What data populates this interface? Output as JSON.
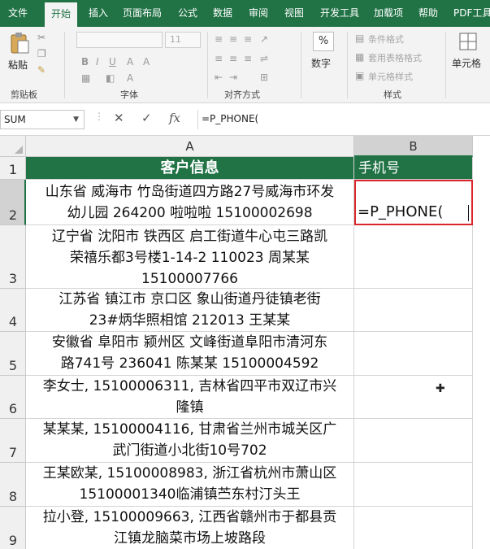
{
  "menu": {
    "tabs": [
      "文件",
      "开始",
      "插入",
      "页面布局",
      "公式",
      "数据",
      "审阅",
      "视图",
      "开发工具",
      "加载项",
      "帮助",
      "PDF工具"
    ],
    "active": "开始"
  },
  "ribbon": {
    "clipboard": {
      "paste_label": "粘贴",
      "group_label": "剪贴板"
    },
    "font": {
      "size_value": "11",
      "group_label": "字体"
    },
    "alignment": {
      "group_label": "对齐方式"
    },
    "number": {
      "symbol": "%",
      "label": "数字"
    },
    "styles": {
      "items": [
        "条件格式",
        "套用表格格式",
        "单元格样式"
      ],
      "group_label": "样式"
    },
    "cells": {
      "label": "单元格"
    }
  },
  "formula_bar": {
    "name_box": "SUM",
    "cancel_icon": "✕",
    "enter_icon": "✓",
    "fx_label": "fx",
    "formula": "=P_PHONE("
  },
  "grid": {
    "columns": [
      "A",
      "B"
    ],
    "rows": [
      "1",
      "2",
      "3",
      "4",
      "5",
      "6",
      "7",
      "8",
      "9"
    ],
    "header_a": "客户信息",
    "header_b": "手机号",
    "cells_a": [
      [
        "山东省  威海市 竹岛街道四方路27号威海市环发",
        "幼儿园  264200  啦啦啦  15100002698"
      ],
      [
        "辽宁省  沈阳市  铁西区  启工街道牛心屯三路凯",
        "荣禧乐都3号楼1-14-2  110023  周某某",
        "15100007766"
      ],
      [
        "江苏省  镇江市  京口区  象山街道丹徒镇老街",
        "23#炳华照相馆  212013  王某某"
      ],
      [
        "安徽省  阜阳市  颍州区  文峰街道阜阳市清河东",
        "路741号  236041  陈某某  15100004592"
      ],
      [
        "李女士, 15100006311, 吉林省四平市双辽市兴",
        "隆镇"
      ],
      [
        "某某某, 15100004116, 甘肃省兰州市城关区广",
        "武门街道小北街10号702"
      ],
      [
        "王某欧某, 15100008983, 浙江省杭州市萧山区",
        "15100001340临浦镇苎东村汀头王"
      ],
      [
        "拉小登, 15100009663, 江西省赣州市于都县贡",
        "江镇龙脑菜市场上坡路段"
      ]
    ],
    "editing_text": "=P_PHONE("
  },
  "colors": {
    "excel_green": "#217346",
    "selection_red": "#d9262c"
  }
}
